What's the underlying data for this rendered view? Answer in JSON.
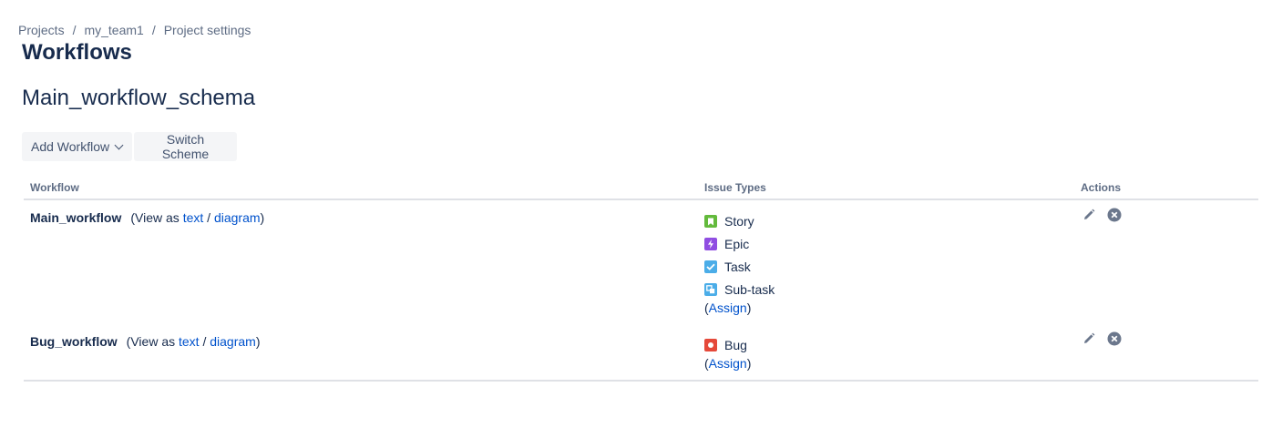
{
  "breadcrumb": {
    "items": [
      "Projects",
      "my_team1",
      "Project settings"
    ],
    "separator": "/"
  },
  "page": {
    "title": "Workflows",
    "scheme_name": "Main_workflow_schema"
  },
  "toolbar": {
    "add_workflow_label": "Add Workflow",
    "switch_scheme_label": "Switch Scheme"
  },
  "table": {
    "headers": {
      "workflow": "Workflow",
      "issue_types": "Issue Types",
      "actions": "Actions"
    },
    "rows": [
      {
        "name": "Main_workflow",
        "view_prefix": "(View as ",
        "text_link": "text",
        "slash": " / ",
        "diagram_link": "diagram",
        "view_suffix": ")",
        "issue_types": [
          {
            "label": "Story",
            "icon": "story-icon",
            "color": "#63ba3c"
          },
          {
            "label": "Epic",
            "icon": "epic-icon",
            "color": "#904ee2"
          },
          {
            "label": "Task",
            "icon": "task-icon",
            "color": "#4bade8"
          },
          {
            "label": "Sub-task",
            "icon": "subtask-icon",
            "color": "#4bade8"
          }
        ],
        "assign_open": "(",
        "assign_label": "Assign",
        "assign_close": ")"
      },
      {
        "name": "Bug_workflow",
        "view_prefix": "(View as ",
        "text_link": "text",
        "slash": " / ",
        "diagram_link": "diagram",
        "view_suffix": ")",
        "issue_types": [
          {
            "label": "Bug",
            "icon": "bug-icon",
            "color": "#e5493a"
          }
        ],
        "assign_open": "(",
        "assign_label": "Assign",
        "assign_close": ")"
      }
    ]
  },
  "colors": {
    "link": "#0052cc",
    "text": "#172b4d",
    "muted": "#5e6c84",
    "button_bg": "#f4f5f7",
    "divider": "#dfe1e6",
    "action_icon": "#6b778c"
  }
}
